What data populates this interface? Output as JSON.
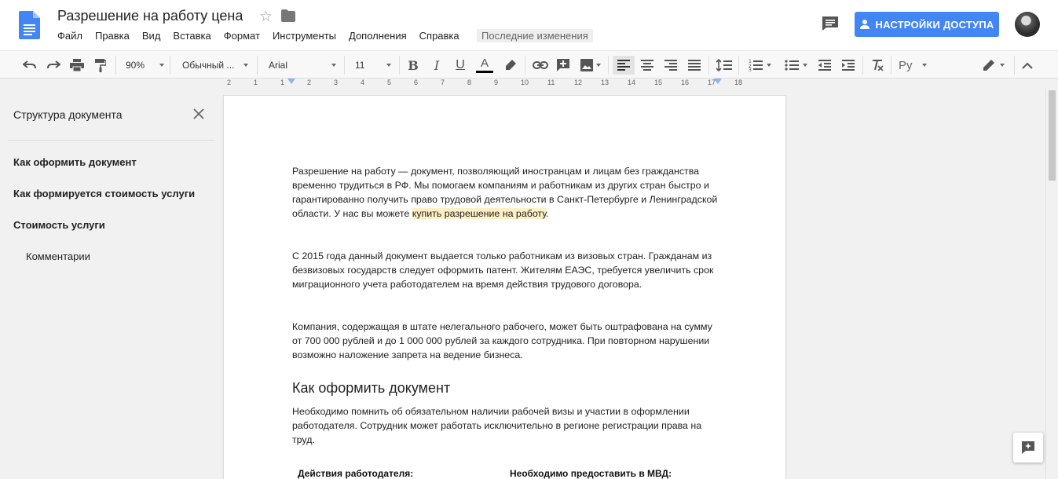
{
  "header": {
    "title": "Разрешение на работу цена",
    "menu": [
      "Файл",
      "Правка",
      "Вид",
      "Вставка",
      "Формат",
      "Инструменты",
      "Дополнения",
      "Справка"
    ],
    "last_edit": "Последние изменения",
    "share_label": "НАСТРОЙКИ ДОСТУПА"
  },
  "toolbar": {
    "zoom": "90%",
    "style": "Обычный ...",
    "font": "Arial",
    "size": "11",
    "language": "Ру"
  },
  "ruler": {
    "ticks": [
      "2",
      "1",
      "1",
      "2",
      "3",
      "4",
      "5",
      "6",
      "7",
      "8",
      "9",
      "10",
      "11",
      "12",
      "13",
      "14",
      "15",
      "16",
      "17",
      "18"
    ]
  },
  "outline": {
    "title": "Структура документа",
    "items": [
      {
        "label": "Как оформить документ",
        "level": 1
      },
      {
        "label": "Как формируется стоимость услуги",
        "level": 1
      },
      {
        "label": "Стоимость услуги",
        "level": 1
      },
      {
        "label": "Комментарии",
        "level": 2
      }
    ]
  },
  "document": {
    "p1_before": "Разрешение на работу — документ, позволяющий иностранцам и лицам без гражданства временно трудиться в РФ. Мы помогаем компаниям и работникам из других стран быстро и гарантированно получить право трудовой деятельности в Санкт-Петербурге и Ленинградской области. У нас вы можете ",
    "p1_link": "купить разрешение на работу",
    "p1_after": ".",
    "p2": "С 2015 года данный документ выдается только работникам из визовых стран. Гражданам из безвизовых государств следует оформить патент. Жителям ЕАЭС, требуется увеличить срок миграционного учета работодателем на время действия трудового договора.",
    "p3": "Компания, содержащая в штате нелегального рабочего, может быть оштрафована на сумму от 700 000 рублей и до 1 000 000 рублей за каждого сотрудника. При повторном нарушении возможно наложение запрета на ведение бизнеса.",
    "h2": "Как оформить документ",
    "p4": "Необходимо помнить об обязательном наличии рабочей визы и участии в оформлении работодателя. Сотрудник может работать исключительно в регионе регистрации права на труд.",
    "table_col1": "Действия работодателя:",
    "table_col2": "Необходимо предоставить в МВД:"
  }
}
